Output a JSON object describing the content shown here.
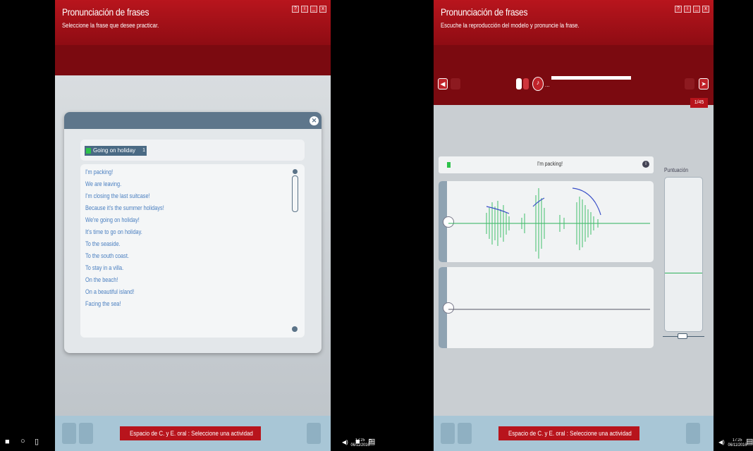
{
  "left": {
    "title": "Pronunciación de frases",
    "subtitle": "Seleccione la frase que desee practicar.",
    "window_buttons": [
      "?",
      "i",
      "_",
      "x"
    ],
    "topic": {
      "label": "Going on holiday",
      "num": "1"
    },
    "phrases": [
      "I'm packing!",
      "We are leaving.",
      "I'm closing the last suitcase!",
      "Because it's the summer holidays!",
      "We're going on holiday!",
      "It's time to go on holiday.",
      "To the seaside.",
      "To the south coast.",
      "To stay in a villa.",
      "On the beach!",
      "On a beautiful island!",
      "Facing the sea!"
    ],
    "status": "Espacio de C. y E. oral : Seleccione una actividad"
  },
  "right": {
    "title": "Pronunciación de frases",
    "subtitle": "Escuche la reproducción del modelo y pronuncie la frase.",
    "window_buttons": [
      "?",
      "i",
      "_",
      "x"
    ],
    "counter": "1/45",
    "phrase": "I'm packing!",
    "info_icon": "i",
    "score_label": "Puntuación",
    "status": "Espacio de C. y E. oral : Seleccione una actividad",
    "ellipsis": "..."
  },
  "taskbar_left": {
    "time": "17:25",
    "date": "06/11/2016"
  },
  "taskbar_right": {
    "time": "17:25",
    "date": "06/11/2016"
  },
  "colors": {
    "brand_red": "#b8141c",
    "phrase_blue": "#4a7fc0",
    "wave_green": "#2cb05a",
    "pitch_blue": "#3b50c8"
  }
}
